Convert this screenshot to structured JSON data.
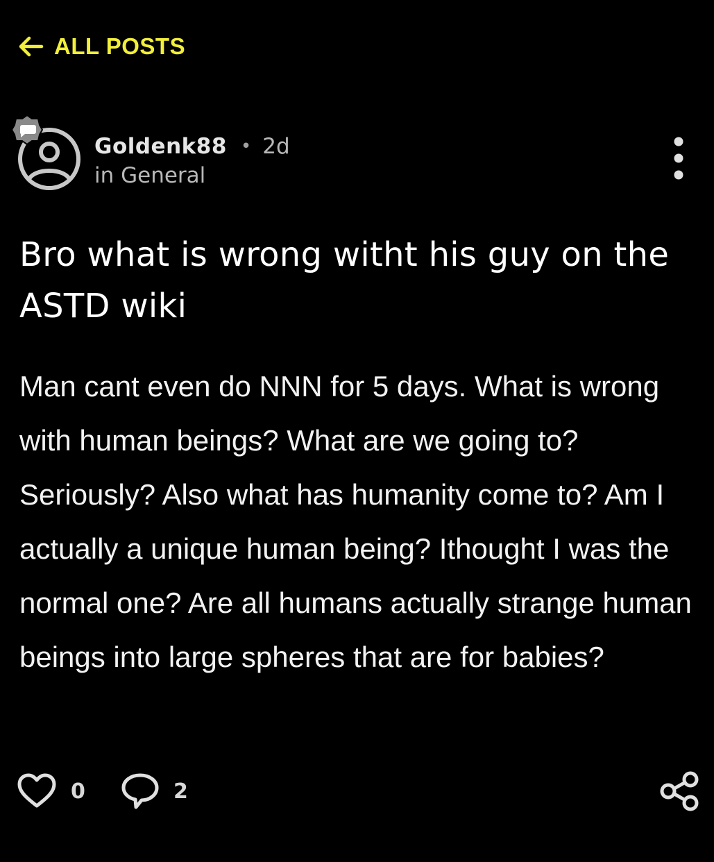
{
  "nav": {
    "back_label": "ALL POSTS",
    "back_icon": "arrow-left-icon"
  },
  "author": {
    "avatar_icon": "default-user-avatar-icon",
    "badge_icon": "moderator-chat-badge-icon",
    "username": "Goldenk88",
    "separator": "•",
    "time_ago": "2d",
    "category": "in General"
  },
  "menu": {
    "icon": "more-vertical-icon"
  },
  "post": {
    "title": "Bro what is wrong witht his guy on the ASTD wiki",
    "body": "Man cant even do NNN for 5 days. What is wrong with human beings? What are we going to? Seriously? Also what has humanity come to? Am I actually a unique human being? Ithought I was the normal one? Are all humans actually strange human beings into large spheres that are for babies?"
  },
  "actions": {
    "like_icon": "heart-icon",
    "like_count": "0",
    "comment_icon": "comment-icon",
    "comment_count": "2",
    "share_icon": "share-icon"
  },
  "colors": {
    "background": "#000000",
    "accent": "#f2ef3a",
    "text_primary": "#ffffff",
    "text_secondary": "#b8b8b8"
  }
}
